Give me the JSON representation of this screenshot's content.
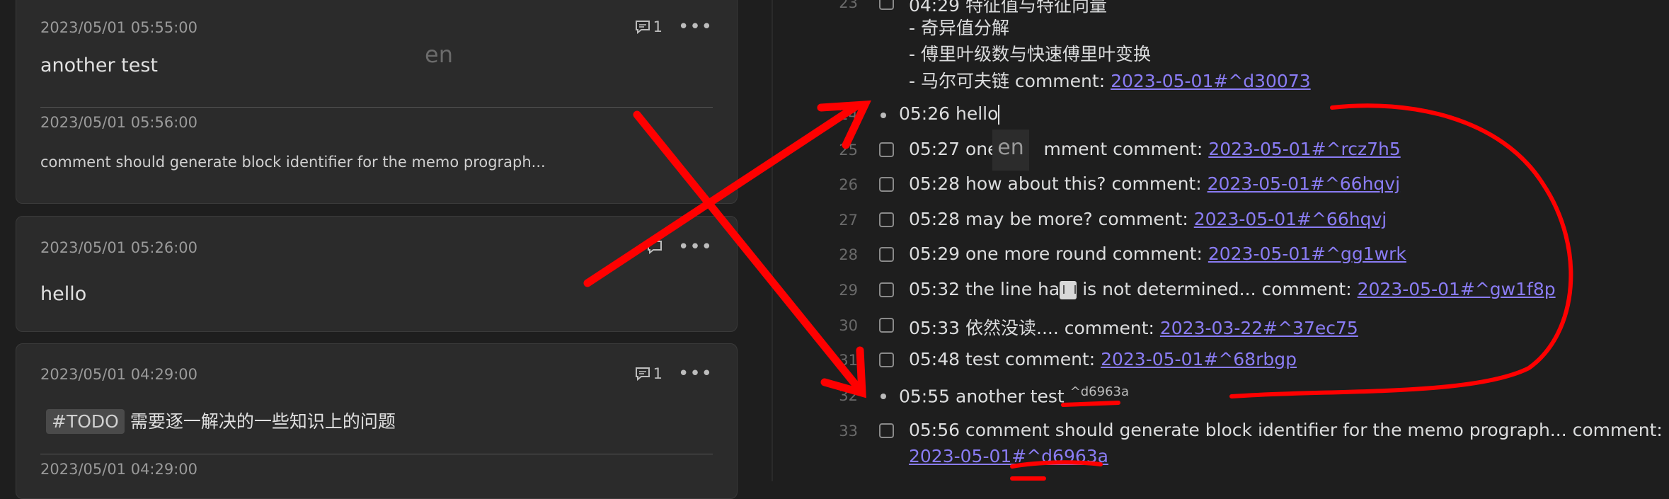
{
  "memos": [
    {
      "time": "2023/05/01 05:55:00",
      "text": "another test",
      "comment_count": "1",
      "sub_time": "2023/05/01 05:56:00",
      "sub_text": "comment should generate block identifier for the memo prograph..."
    },
    {
      "time": "2023/05/01 05:26:00",
      "text": "hello"
    },
    {
      "time": "2023/05/01 04:29:00",
      "tag": "#TODO",
      "text": "需要逐一解决的一些知识上的问题",
      "comment_count": "1",
      "sub_time": "2023/05/01 04:29:00"
    }
  ],
  "ime_indicator": "en",
  "editor": {
    "partial_top": {
      "line_number": "23",
      "text": "04:29 特征值与特征向量"
    },
    "continuation_lines": [
      "- 奇异值分解",
      "- 傅里叶级数与快速傅里叶变换"
    ],
    "markov_line": {
      "text": "- 马尔可夫链 comment: ",
      "link": "2023-05-01#^d30073"
    },
    "lines": [
      {
        "number": "24",
        "type": "bullet",
        "text": "05:26 hello"
      },
      {
        "number": "25",
        "type": "task",
        "text_before": "05:27 one ",
        "text_after": "mment comment: ",
        "link": "2023-05-01#^rcz7h5"
      },
      {
        "number": "26",
        "type": "task",
        "text": "05:28 how about this? comment: ",
        "link": "2023-05-01#^66hqvj"
      },
      {
        "number": "27",
        "type": "task",
        "text": "05:28 may be more? comment: ",
        "link": "2023-05-01#^66hqvj"
      },
      {
        "number": "28",
        "type": "task",
        "text": "05:29 one more round comment: ",
        "link": "2023-05-01#^gg1wrk"
      },
      {
        "number": "29",
        "type": "task",
        "text_before": "05:32 the line ha",
        "text_after": "is not determined... comment: ",
        "link": "2023-05-01#^gw1f8p"
      },
      {
        "number": "30",
        "type": "task",
        "text": "05:33 依然没读.... comment: ",
        "link": "2023-03-22#^37ec75"
      },
      {
        "number": "31",
        "type": "task",
        "text": "05:48 test comment: ",
        "link": "2023-05-01#^68rbgp"
      },
      {
        "number": "32",
        "type": "bullet",
        "text": "05:55 another test ",
        "block_id": "^d6963a"
      },
      {
        "number": "33",
        "type": "task",
        "text": "05:56 comment should generate block identifier for the memo prograph... comment:",
        "link": "2023-05-01#^d6963a"
      }
    ]
  },
  "colors": {
    "annotation": "#ff0000",
    "link": "#8a7cf4",
    "background": "#1e1e1e",
    "card": "#2b2b2b"
  }
}
